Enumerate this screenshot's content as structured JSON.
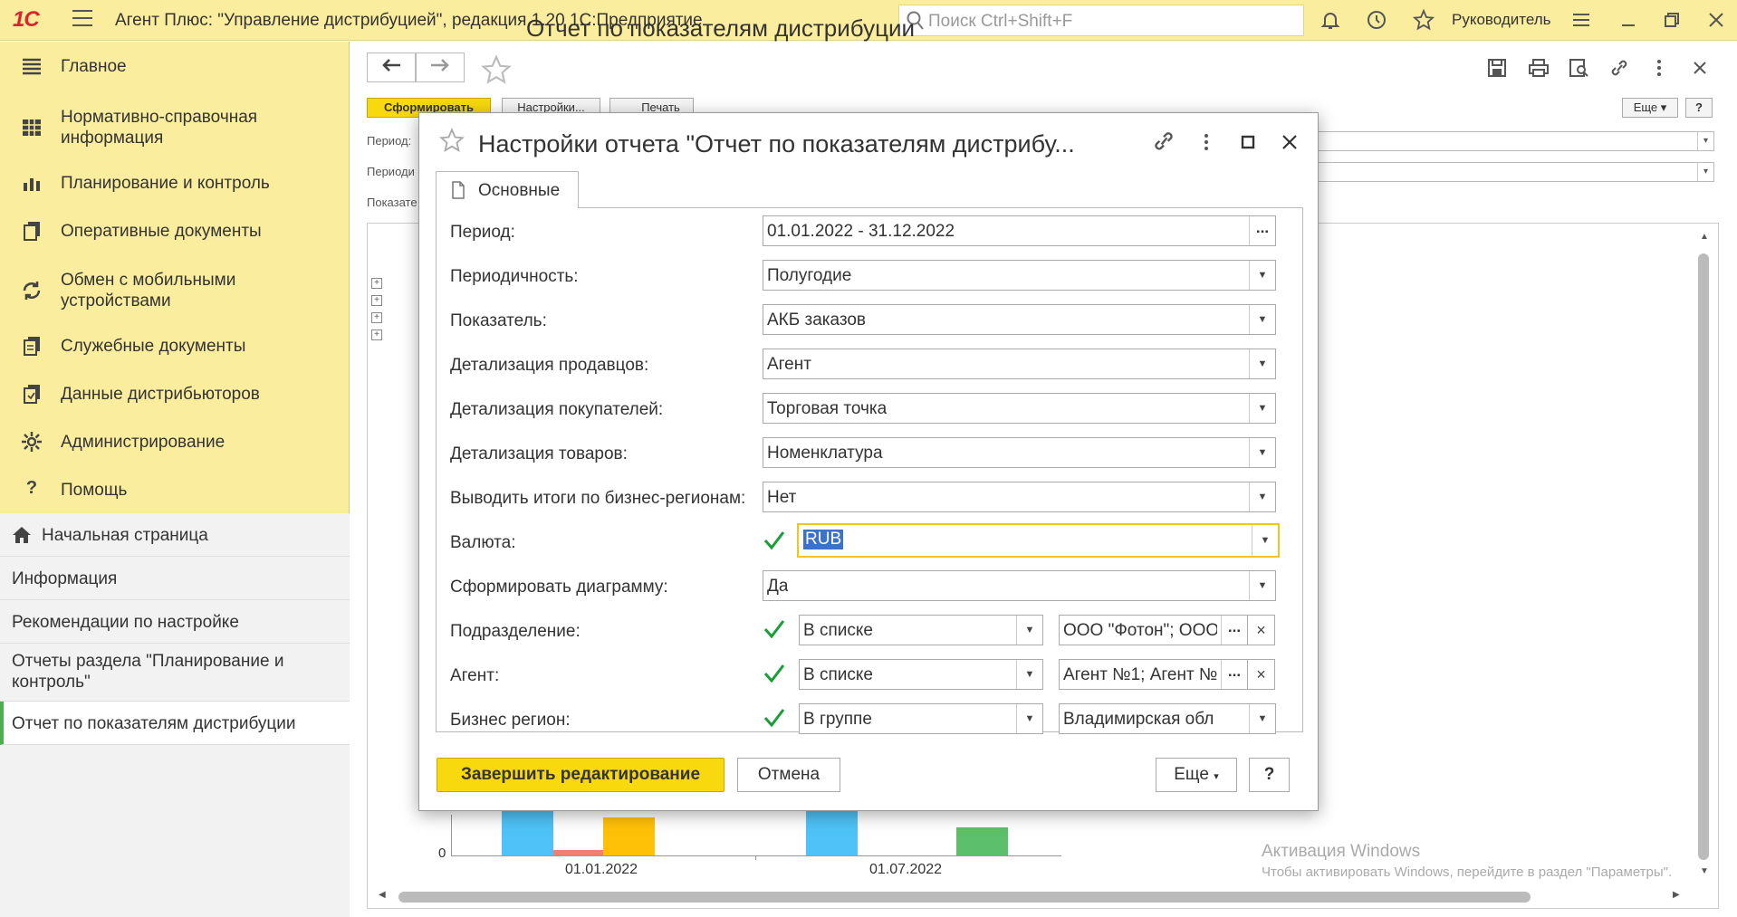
{
  "app": {
    "logo": "1С",
    "title": "Агент Плюс: \"Управление дистрибуцией\", редакция 1.20 1С:Предприятие",
    "search_placeholder": "Поиск Ctrl+Shift+F",
    "user": "Руководитель"
  },
  "sidebar": {
    "sections": [
      {
        "label": "Главное",
        "icon": "menu-lines-icon"
      },
      {
        "label": "Нормативно-справочная информация",
        "icon": "grid-icon"
      },
      {
        "label": "Планирование и контроль",
        "icon": "bar-chart-icon"
      },
      {
        "label": "Оперативные документы",
        "icon": "documents-icon"
      },
      {
        "label": "Обмен с мобильными устройствами",
        "icon": "sync-icon"
      },
      {
        "label": "Служебные документы",
        "icon": "service-docs-icon"
      },
      {
        "label": "Данные дистрибьюторов",
        "icon": "distributor-data-icon"
      },
      {
        "label": "Администрирование",
        "icon": "gear-icon"
      },
      {
        "label": "Помощь",
        "icon": "question-icon"
      }
    ],
    "open_items": [
      {
        "label": "Начальная страница"
      },
      {
        "label": "Информация"
      },
      {
        "label": "Рекомендации по настройке"
      },
      {
        "label": "Отчеты раздела \"Планирование и контроль\""
      },
      {
        "label": "Отчет по показателям дистрибуции"
      }
    ]
  },
  "form": {
    "title": "Отчет по показателям дистрибуции",
    "buttons": {
      "generate": "Сформировать",
      "settings": "Настройки...",
      "print": "Печать",
      "more": "Еще",
      "help": "?"
    },
    "labels": {
      "period": "Период:",
      "periodicity": "Периоди",
      "indicator": "Показате"
    }
  },
  "chart": {
    "zero_label": "0",
    "x_labels": [
      "01.01.2022",
      "01.07.2022"
    ],
    "colors": {
      "blue": "#4fc3f7",
      "red": "#f08070",
      "orange": "#ffc107",
      "green": "#5cbf6b"
    }
  },
  "watermark": {
    "line1": "Активация Windows",
    "line2": "Чтобы активировать Windows, перейдите в раздел \"Параметры\"."
  },
  "dialog": {
    "title": "Настройки отчета \"Отчет по показателям дистрибу...",
    "tab": "Основные",
    "rows": [
      {
        "label": "Период:",
        "value": "01.01.2022 - 31.12.2022"
      },
      {
        "label": "Периодичность:",
        "value": "Полугодие"
      },
      {
        "label": "Показатель:",
        "value": "АКБ заказов"
      },
      {
        "label": "Детализация продавцов:",
        "value": "Агент"
      },
      {
        "label": "Детализация покупателей:",
        "value": "Торговая точка"
      },
      {
        "label": "Детализация товаров:",
        "value": "Номенклатура"
      },
      {
        "label": "Выводить итоги по бизнес-регионам:",
        "value": "Нет"
      },
      {
        "label": "Валюта:",
        "value": "RUB"
      },
      {
        "label": "Сформировать диаграмму:",
        "value": "Да"
      },
      {
        "label": "Подразделение:",
        "condition": "В списке",
        "value": "ООО \"Фотон\"; ООО"
      },
      {
        "label": "Агент:",
        "condition": "В списке",
        "value": "Агент №1; Агент №"
      },
      {
        "label": "Бизнес регион:",
        "condition": "В группе",
        "value": "Владимирская обл"
      }
    ],
    "buttons": {
      "finish": "Завершить редактирование",
      "cancel": "Отмена",
      "more": "Еще",
      "help": "?"
    }
  }
}
